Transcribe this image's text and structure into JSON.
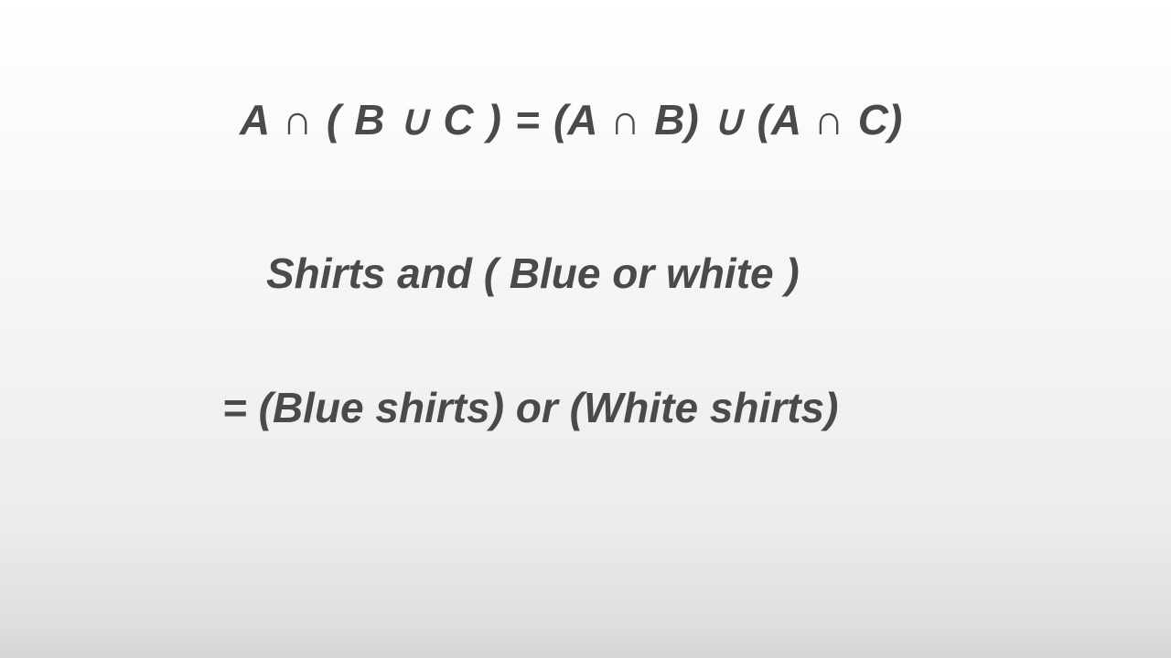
{
  "colors": {
    "text": "#4a4a4a",
    "background_top": "#ffffff",
    "background_bottom": "#d4d4d4"
  },
  "slide": {
    "formula": "A ∩ ( B ∪ C ) = (A ∩ B) ∪ (A ∩ C)",
    "example_line_1": "Shirts and ( Blue or white )",
    "example_line_2": "= (Blue shirts) or (White shirts)"
  }
}
